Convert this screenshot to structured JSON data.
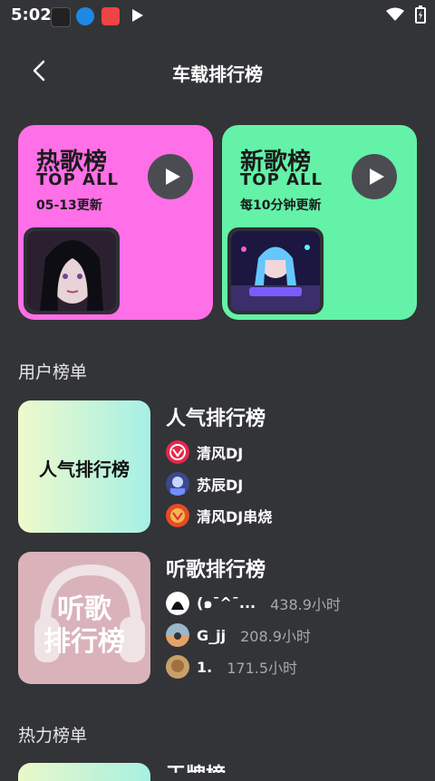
{
  "status": {
    "time": "5:02"
  },
  "header": {
    "title": "车载排行榜"
  },
  "top_cards": [
    {
      "title": "热歌榜",
      "subtitle": "TOP ALL",
      "update": "05-13更新"
    },
    {
      "title": "新歌榜",
      "subtitle": "TOP ALL",
      "update": "每10分钟更新"
    }
  ],
  "sections": {
    "user": "用户榜单",
    "hot": "热力榜单"
  },
  "popularity": {
    "cover_text": "人气排行榜",
    "title": "人气排行榜",
    "items": [
      "清风DJ",
      "苏辰DJ",
      "清风DJ串烧"
    ]
  },
  "listening": {
    "title": "听歌排行榜",
    "cover_lines": [
      "听歌",
      "排行榜"
    ],
    "items": [
      {
        "name": "(๑ˉ^ˉ...",
        "hours": "438.9小时"
      },
      {
        "name": "G_jj",
        "hours": "208.9小时"
      },
      {
        "name": "1.",
        "hours": "171.5小时"
      }
    ]
  },
  "peek_title": "王牌榜"
}
